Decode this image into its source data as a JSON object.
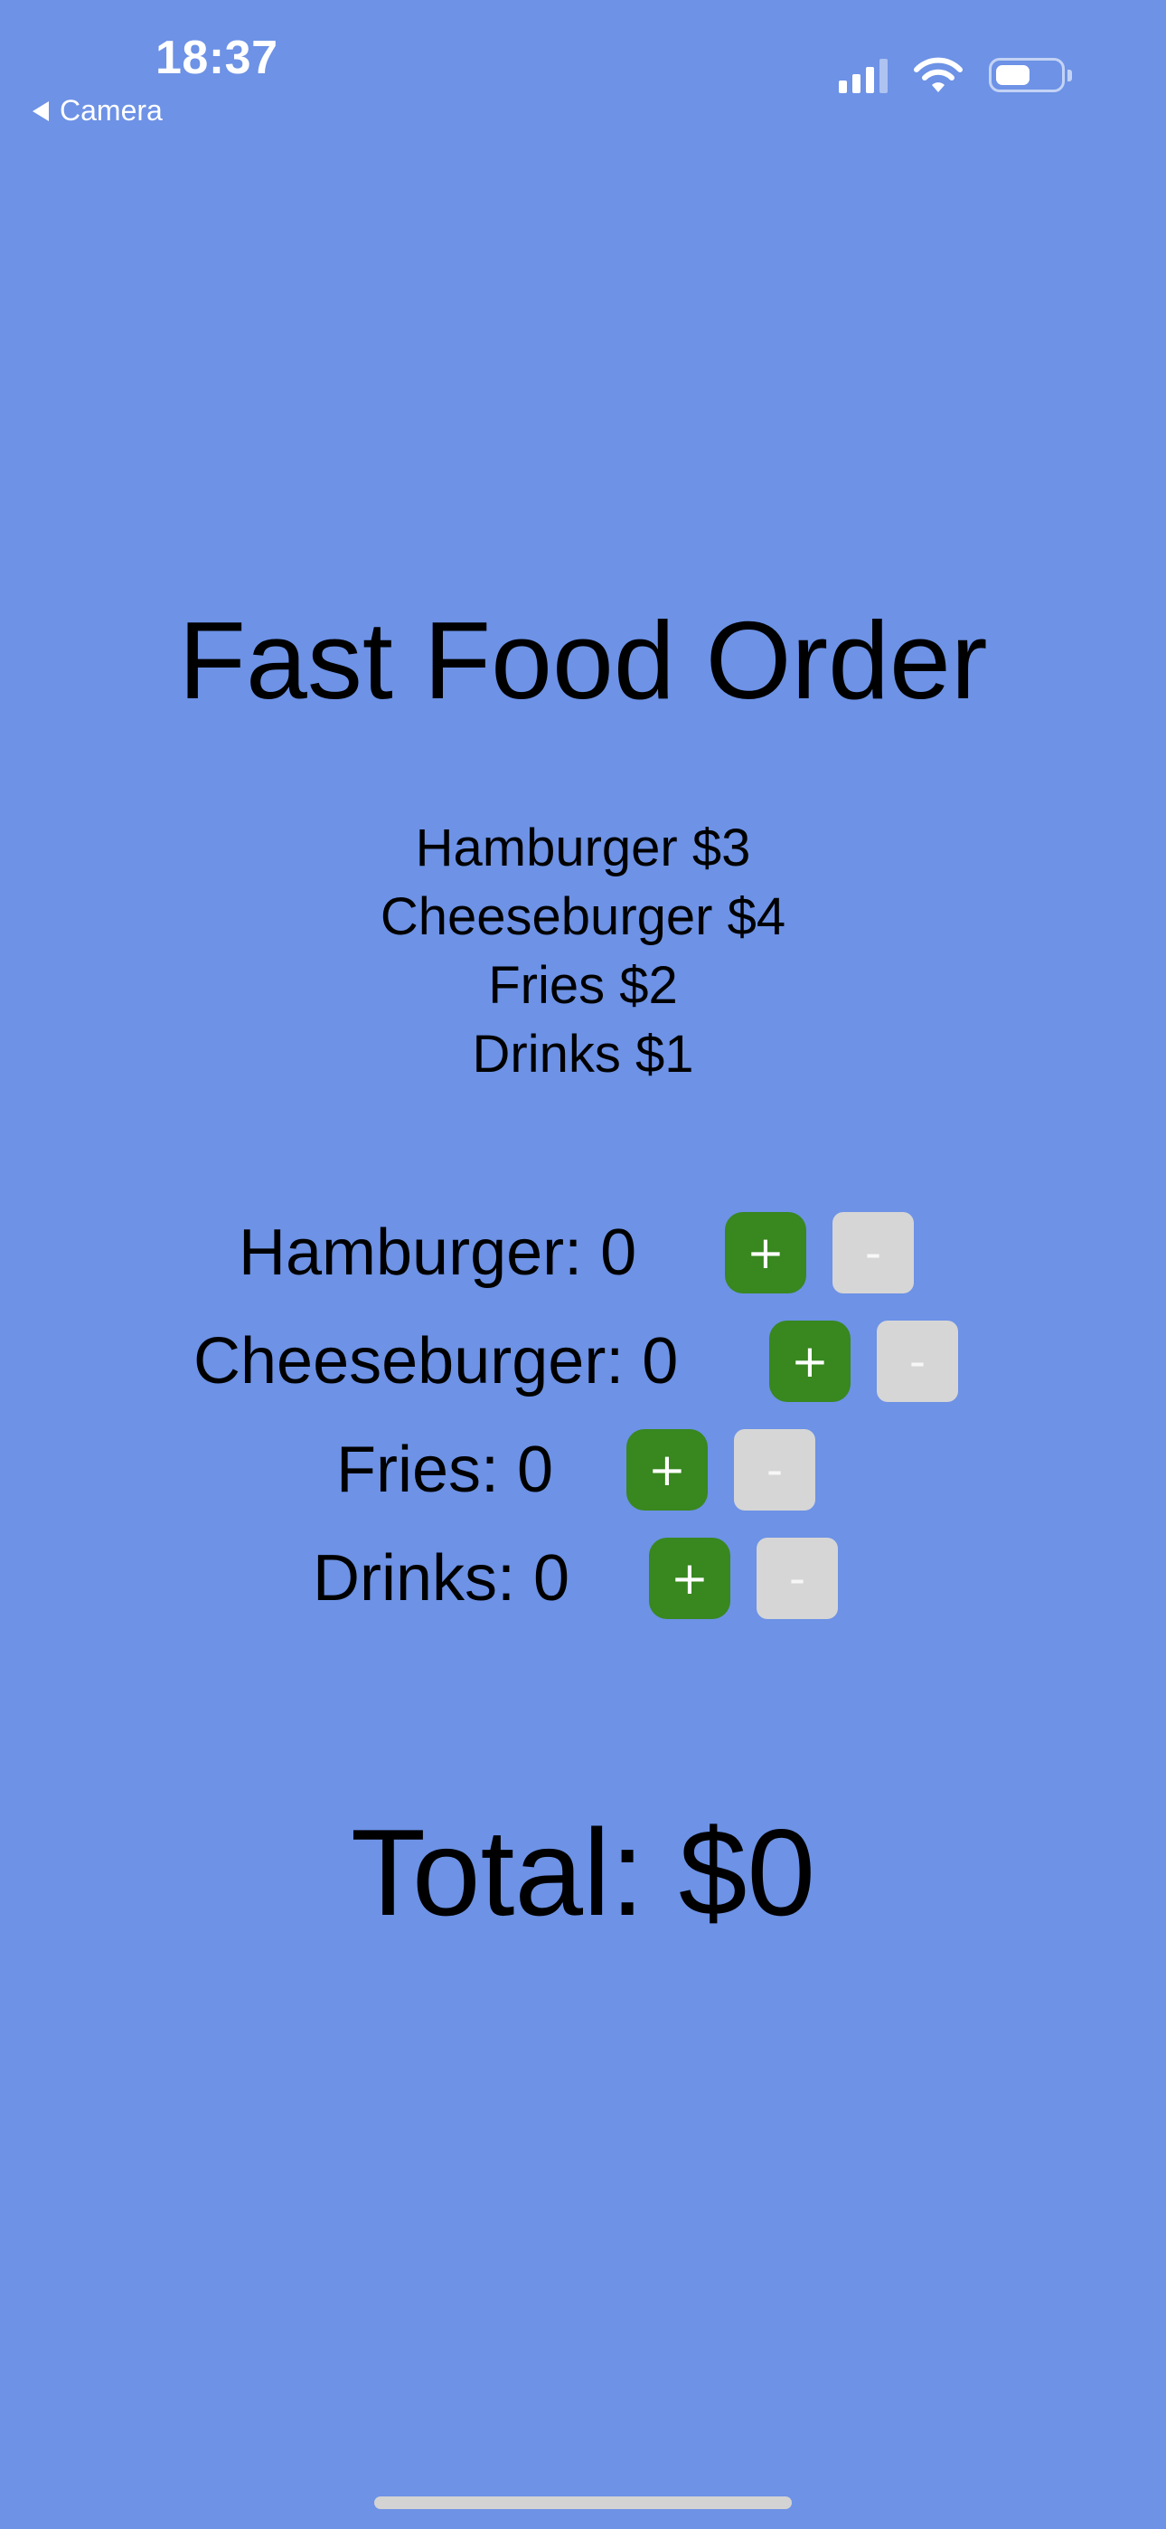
{
  "status_bar": {
    "time": "18:37",
    "back_app": "Camera",
    "icons": [
      "cellular-signal-icon",
      "wifi-icon",
      "battery-icon"
    ],
    "battery_level": 0.55
  },
  "title": "Fast Food Order",
  "menu": [
    "Hamburger $3",
    "Cheeseburger $4",
    "Fries $2",
    "Drinks $1"
  ],
  "order_items": [
    {
      "label": "Hamburger: 0",
      "plus": "+",
      "minus": "-"
    },
    {
      "label": "Cheeseburger: 0",
      "plus": "+",
      "minus": "-"
    },
    {
      "label": "Fries: 0",
      "plus": "+",
      "minus": "-"
    },
    {
      "label": "Drinks: 0",
      "plus": "+",
      "minus": "-"
    }
  ],
  "total": "Total: $0",
  "colors": {
    "background": "#6d92e6",
    "plus_button": "#38871f",
    "minus_button": "#d6d6d6"
  }
}
